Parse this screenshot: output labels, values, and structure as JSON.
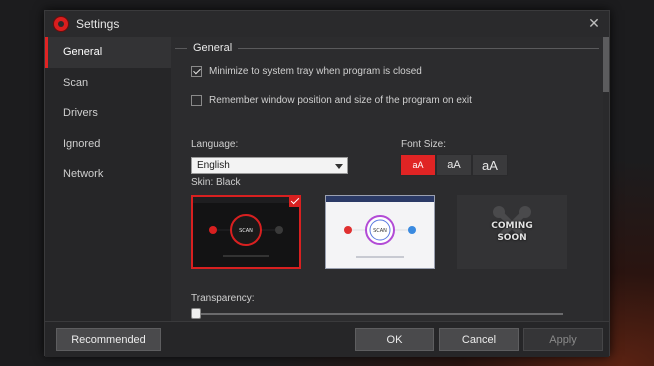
{
  "window": {
    "title": "Settings"
  },
  "sidebar": {
    "items": [
      {
        "label": "General",
        "active": true
      },
      {
        "label": "Scan"
      },
      {
        "label": "Drivers"
      },
      {
        "label": "Ignored"
      },
      {
        "label": "Network"
      }
    ]
  },
  "general": {
    "section_title": "General",
    "options": [
      {
        "label": "Minimize to system tray when program is closed",
        "checked": true
      },
      {
        "label": "Remember window position and size of the program on exit",
        "checked": false
      }
    ],
    "language": {
      "label": "Language:",
      "value": "English"
    },
    "font_size": {
      "label": "Font Size:",
      "options": [
        "aA",
        "aA",
        "aA"
      ],
      "selected_index": 0
    },
    "skin": {
      "label": "Skin: Black",
      "coming_soon_line1": "COMING",
      "coming_soon_line2": "SOON",
      "black_preview_button": "SCAN",
      "white_preview_button": "SCAN"
    },
    "transparency": {
      "label": "Transparency:",
      "value": 0
    }
  },
  "footer": {
    "recommended_label": "Recommended",
    "ok_label": "OK",
    "cancel_label": "Cancel",
    "apply_label": "Apply"
  },
  "colors": {
    "accent": "#e02424",
    "window_bg": "#2c2c2e",
    "sidebar_bg": "#262628"
  }
}
